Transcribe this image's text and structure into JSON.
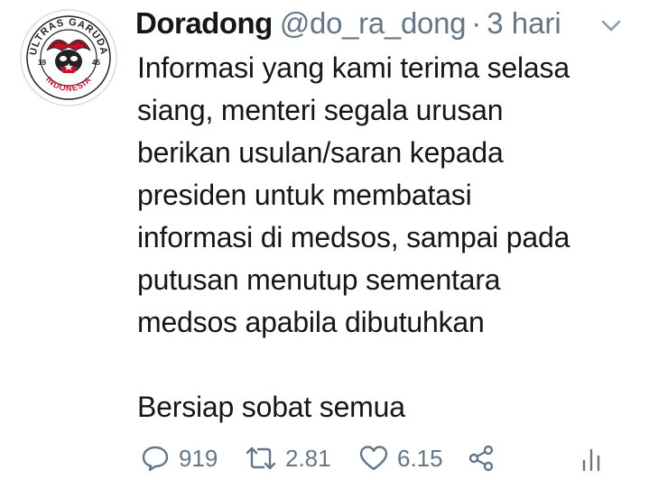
{
  "tweet": {
    "author": {
      "display_name": "Doradong",
      "handle": "@do_ra_dong",
      "separator": "·",
      "time": "3 hari",
      "avatar": {
        "top_text": "ULTRAS GARUDA",
        "bottom_text": "INDONESIA",
        "left_year": "19",
        "right_year": "45"
      }
    },
    "body_lines": [
      "Informasi yang kami terima selasa",
      "siang, menteri segala urusan",
      "berikan usulan/saran kepada",
      "presiden untuk membatasi",
      "informasi di medsos, sampai pada",
      "putusan menutup sementara",
      "medsos apabila dibutuhkan",
      "",
      "Bersiap sobat semua"
    ],
    "actions": {
      "reply_count": "919",
      "retweet_count": "2.81",
      "like_count": "6.15",
      "reply_icon": "reply-icon",
      "retweet_icon": "retweet-icon",
      "like_icon": "heart-icon",
      "share_icon": "share-icon",
      "stats_icon": "stats-icon"
    },
    "colors": {
      "text": "#14171a",
      "secondary": "#657786",
      "avatar_red": "#c8102e"
    }
  }
}
